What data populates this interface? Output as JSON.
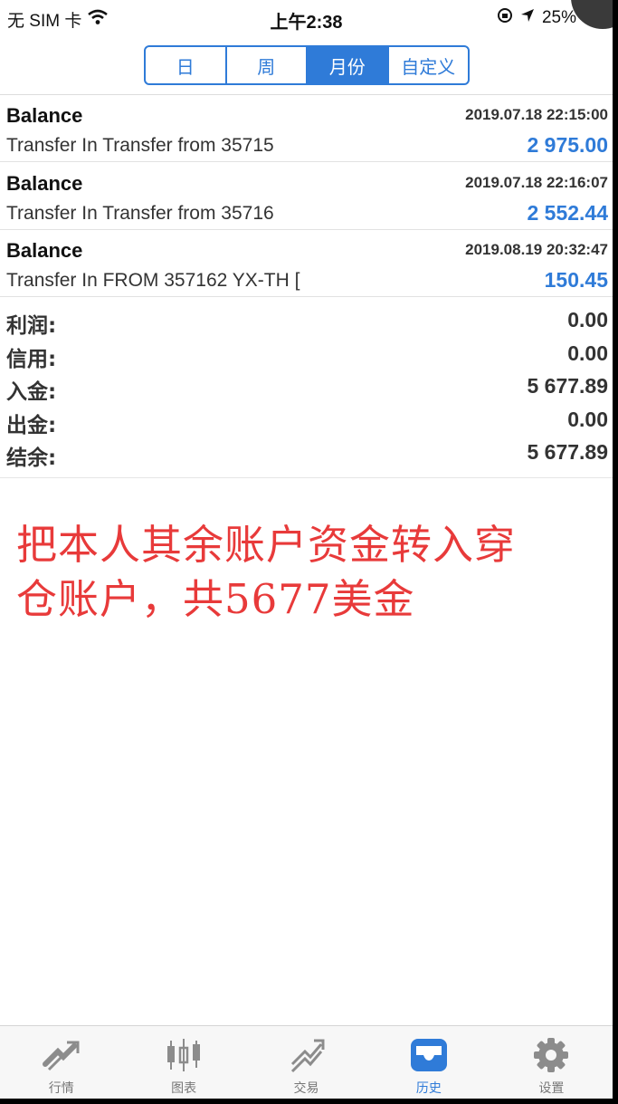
{
  "status_bar": {
    "carrier": "无 SIM 卡",
    "time": "上午2:38",
    "battery": "25%"
  },
  "period_tabs": [
    {
      "label": "日",
      "active": false
    },
    {
      "label": "周",
      "active": false
    },
    {
      "label": "月份",
      "active": true
    },
    {
      "label": "自定义",
      "active": false
    }
  ],
  "records": [
    {
      "type": "Balance",
      "datetime": "2019.07.18 22:15:00",
      "comment": "Transfer In Transfer from 35715",
      "amount": "2 975.00"
    },
    {
      "type": "Balance",
      "datetime": "2019.07.18 22:16:07",
      "comment": "Transfer In Transfer from 35716",
      "amount": "2 552.44"
    },
    {
      "type": "Balance",
      "datetime": "2019.08.19 20:32:47",
      "comment": "Transfer In FROM 357162 YX-TH [",
      "amount": "150.45"
    }
  ],
  "summary": [
    {
      "label": "利润:",
      "value": "0.00"
    },
    {
      "label": "信用:",
      "value": "0.00"
    },
    {
      "label": "入金:",
      "value": "5 677.89"
    },
    {
      "label": "出金:",
      "value": "0.00"
    },
    {
      "label": "结余:",
      "value": "5 677.89"
    }
  ],
  "annotation": {
    "line1": "把本人其余账户资金转入穿",
    "line2": "仓账户，共5677美金"
  },
  "tab_bar": [
    {
      "label": "行情",
      "icon": "quotes-icon",
      "active": false
    },
    {
      "label": "图表",
      "icon": "chart-icon",
      "active": false
    },
    {
      "label": "交易",
      "icon": "trade-icon",
      "active": false
    },
    {
      "label": "历史",
      "icon": "history-icon",
      "active": true
    },
    {
      "label": "设置",
      "icon": "settings-icon",
      "active": false
    }
  ],
  "colors": {
    "accent": "#2f7bd8",
    "annotation": "#e83a3a",
    "inactive_icon": "#8c8c8c"
  }
}
